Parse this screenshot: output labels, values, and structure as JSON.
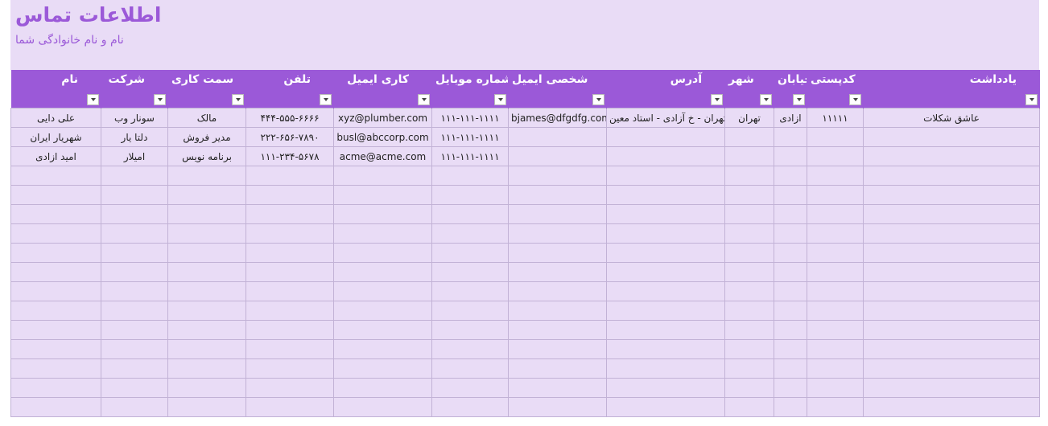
{
  "sheet": {
    "title": "اطلاعات تماس",
    "subtitle": "نام و نام خانوادگی شما"
  },
  "columns": [
    {
      "key": "name",
      "label": "نام"
    },
    {
      "key": "company",
      "label": "شرکت"
    },
    {
      "key": "job",
      "label": "سمت کاری"
    },
    {
      "key": "phone",
      "label": "تلفن"
    },
    {
      "key": "work_email",
      "label": "کاری ایمیل"
    },
    {
      "key": "mobile",
      "label": "شماره موبایل"
    },
    {
      "key": "personal_email",
      "label": "شخصی ایمیل"
    },
    {
      "key": "address",
      "label": "آدرس"
    },
    {
      "key": "city",
      "label": "شهر"
    },
    {
      "key": "street",
      "label": "خیابان"
    },
    {
      "key": "postal",
      "label": "کدپستی"
    },
    {
      "key": "note",
      "label": "یادداشت"
    }
  ],
  "rows": [
    [
      "علی دایی",
      "سونار وب",
      "مالک",
      "۴۴۴-۵۵۵-۶۶۶۶",
      "xyz@plumber.com",
      "۱۱۱-۱۱۱-۱۱۱۱",
      "bjames@dfgdfg.com",
      "تهران - خ آزادی - استاد معین",
      "تهران",
      "ازادی",
      "۱۱۱۱۱",
      "عاشق شکلات"
    ],
    [
      "شهریار ایران",
      "دلتا یار",
      "مدیر فروش",
      "۲۲۲-۶۵۶-۷۸۹۰",
      "busl@abccorp.com",
      "۱۱۱-۱۱۱-۱۱۱۱",
      "",
      "",
      "",
      "",
      "",
      ""
    ],
    [
      "امید ازادی",
      "امیلار",
      "برنامه نویس",
      "۱۱۱-۲۳۴-۵۶۷۸",
      "acme@acme.com",
      "۱۱۱-۱۱۱-۱۱۱۱",
      "",
      "",
      "",
      "",
      "",
      ""
    ]
  ],
  "empty_row_count": 13,
  "colors": {
    "header_bg": "#9b59d8",
    "band_bg": "#e9dcf6",
    "title_color": "#9b59d8"
  },
  "icons": {
    "filter_button": "dropdown-arrow-icon"
  }
}
